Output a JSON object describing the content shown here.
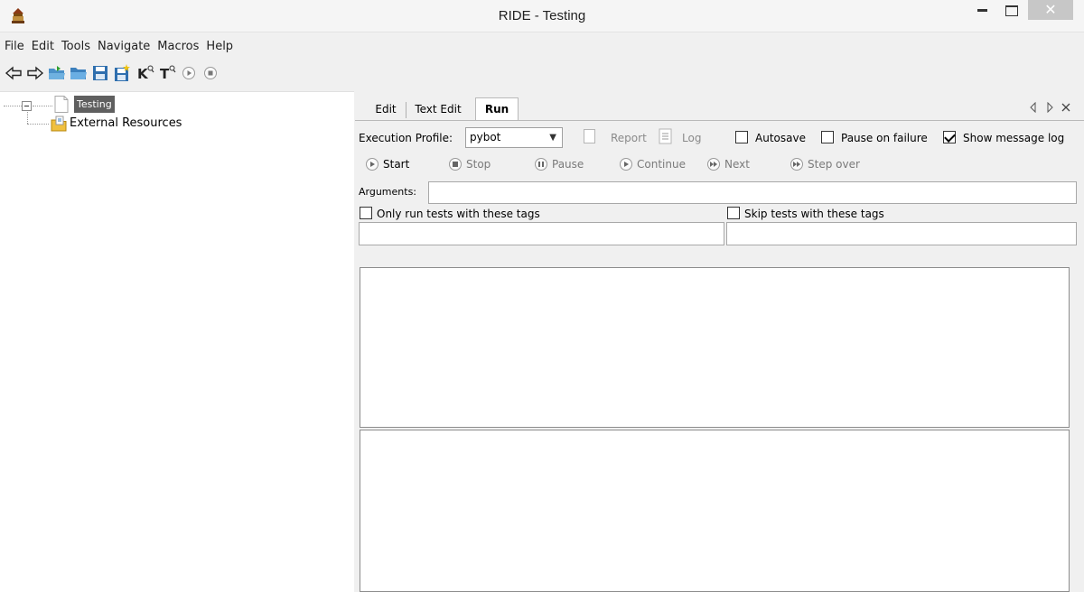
{
  "window": {
    "title": "RIDE - Testing"
  },
  "menu": [
    "File",
    "Edit",
    "Tools",
    "Navigate",
    "Macros",
    "Help"
  ],
  "toolbar": [
    "back-arrow-icon",
    "forward-arrow-icon",
    "open-directory-icon",
    "open-folder-icon",
    "save-icon",
    "save-all-icon",
    "search-keywords-icon",
    "search-tests-icon",
    "run-icon",
    "stop-icon"
  ],
  "tree": {
    "root": "Testing",
    "child": "External Resources"
  },
  "tabs": {
    "edit": "Edit",
    "text_edit": "Text Edit",
    "run": "Run"
  },
  "run": {
    "profile_label": "Execution Profile:",
    "profile_value": "pybot",
    "report": "Report",
    "log": "Log",
    "autosave": "Autosave",
    "pause_on_failure": "Pause on failure",
    "show_message_log": "Show message log",
    "show_message_log_checked": true,
    "start": "Start",
    "stop": "Stop",
    "pause": "Pause",
    "continue": "Continue",
    "next": "Next",
    "step_over": "Step over",
    "arguments_label": "Arguments:",
    "arguments_value": "",
    "only_tags_label": "Only run tests with these tags",
    "skip_tags_label": "Skip tests with these tags"
  }
}
